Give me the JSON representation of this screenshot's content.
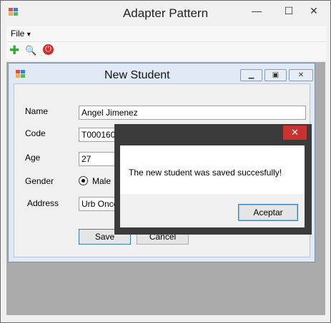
{
  "main_window": {
    "title": "Adapter Pattern",
    "controls": {
      "minimize": "—",
      "maximize": "☐",
      "close": "✕"
    }
  },
  "menu": {
    "file_label": "File",
    "file_arrow": "▾"
  },
  "toolbar": {
    "icons": [
      "add-icon",
      "search-icon",
      "power-icon"
    ],
    "add_glyph": "✚",
    "search_glyph": "🔍",
    "power_glyph": "⏻"
  },
  "child_window": {
    "title": "New Student",
    "controls": {
      "minimize": "▁",
      "maximize": "▣",
      "close": "✕"
    },
    "form": {
      "name_label": "Name",
      "name_value": "Angel Jimenez",
      "code_label": "Code",
      "code_value": "T0001604",
      "age_label": "Age",
      "age_value": "27",
      "gender_label": "Gender",
      "gender_option": "Male",
      "address_label": "Address",
      "address_value": "Urb Once",
      "save_label": "Save",
      "cancel_label": "Cancel"
    }
  },
  "message_box": {
    "text": "The new student was saved succesfully!",
    "ok_label": "Aceptar",
    "close": "✕"
  },
  "colors": {
    "close_red": "#c8332f",
    "accent_blue": "#3c7fb1",
    "child_frame": "#dfeaf6",
    "mdi_background": "#ababab",
    "dialog_frame": "#3b3b3b"
  }
}
